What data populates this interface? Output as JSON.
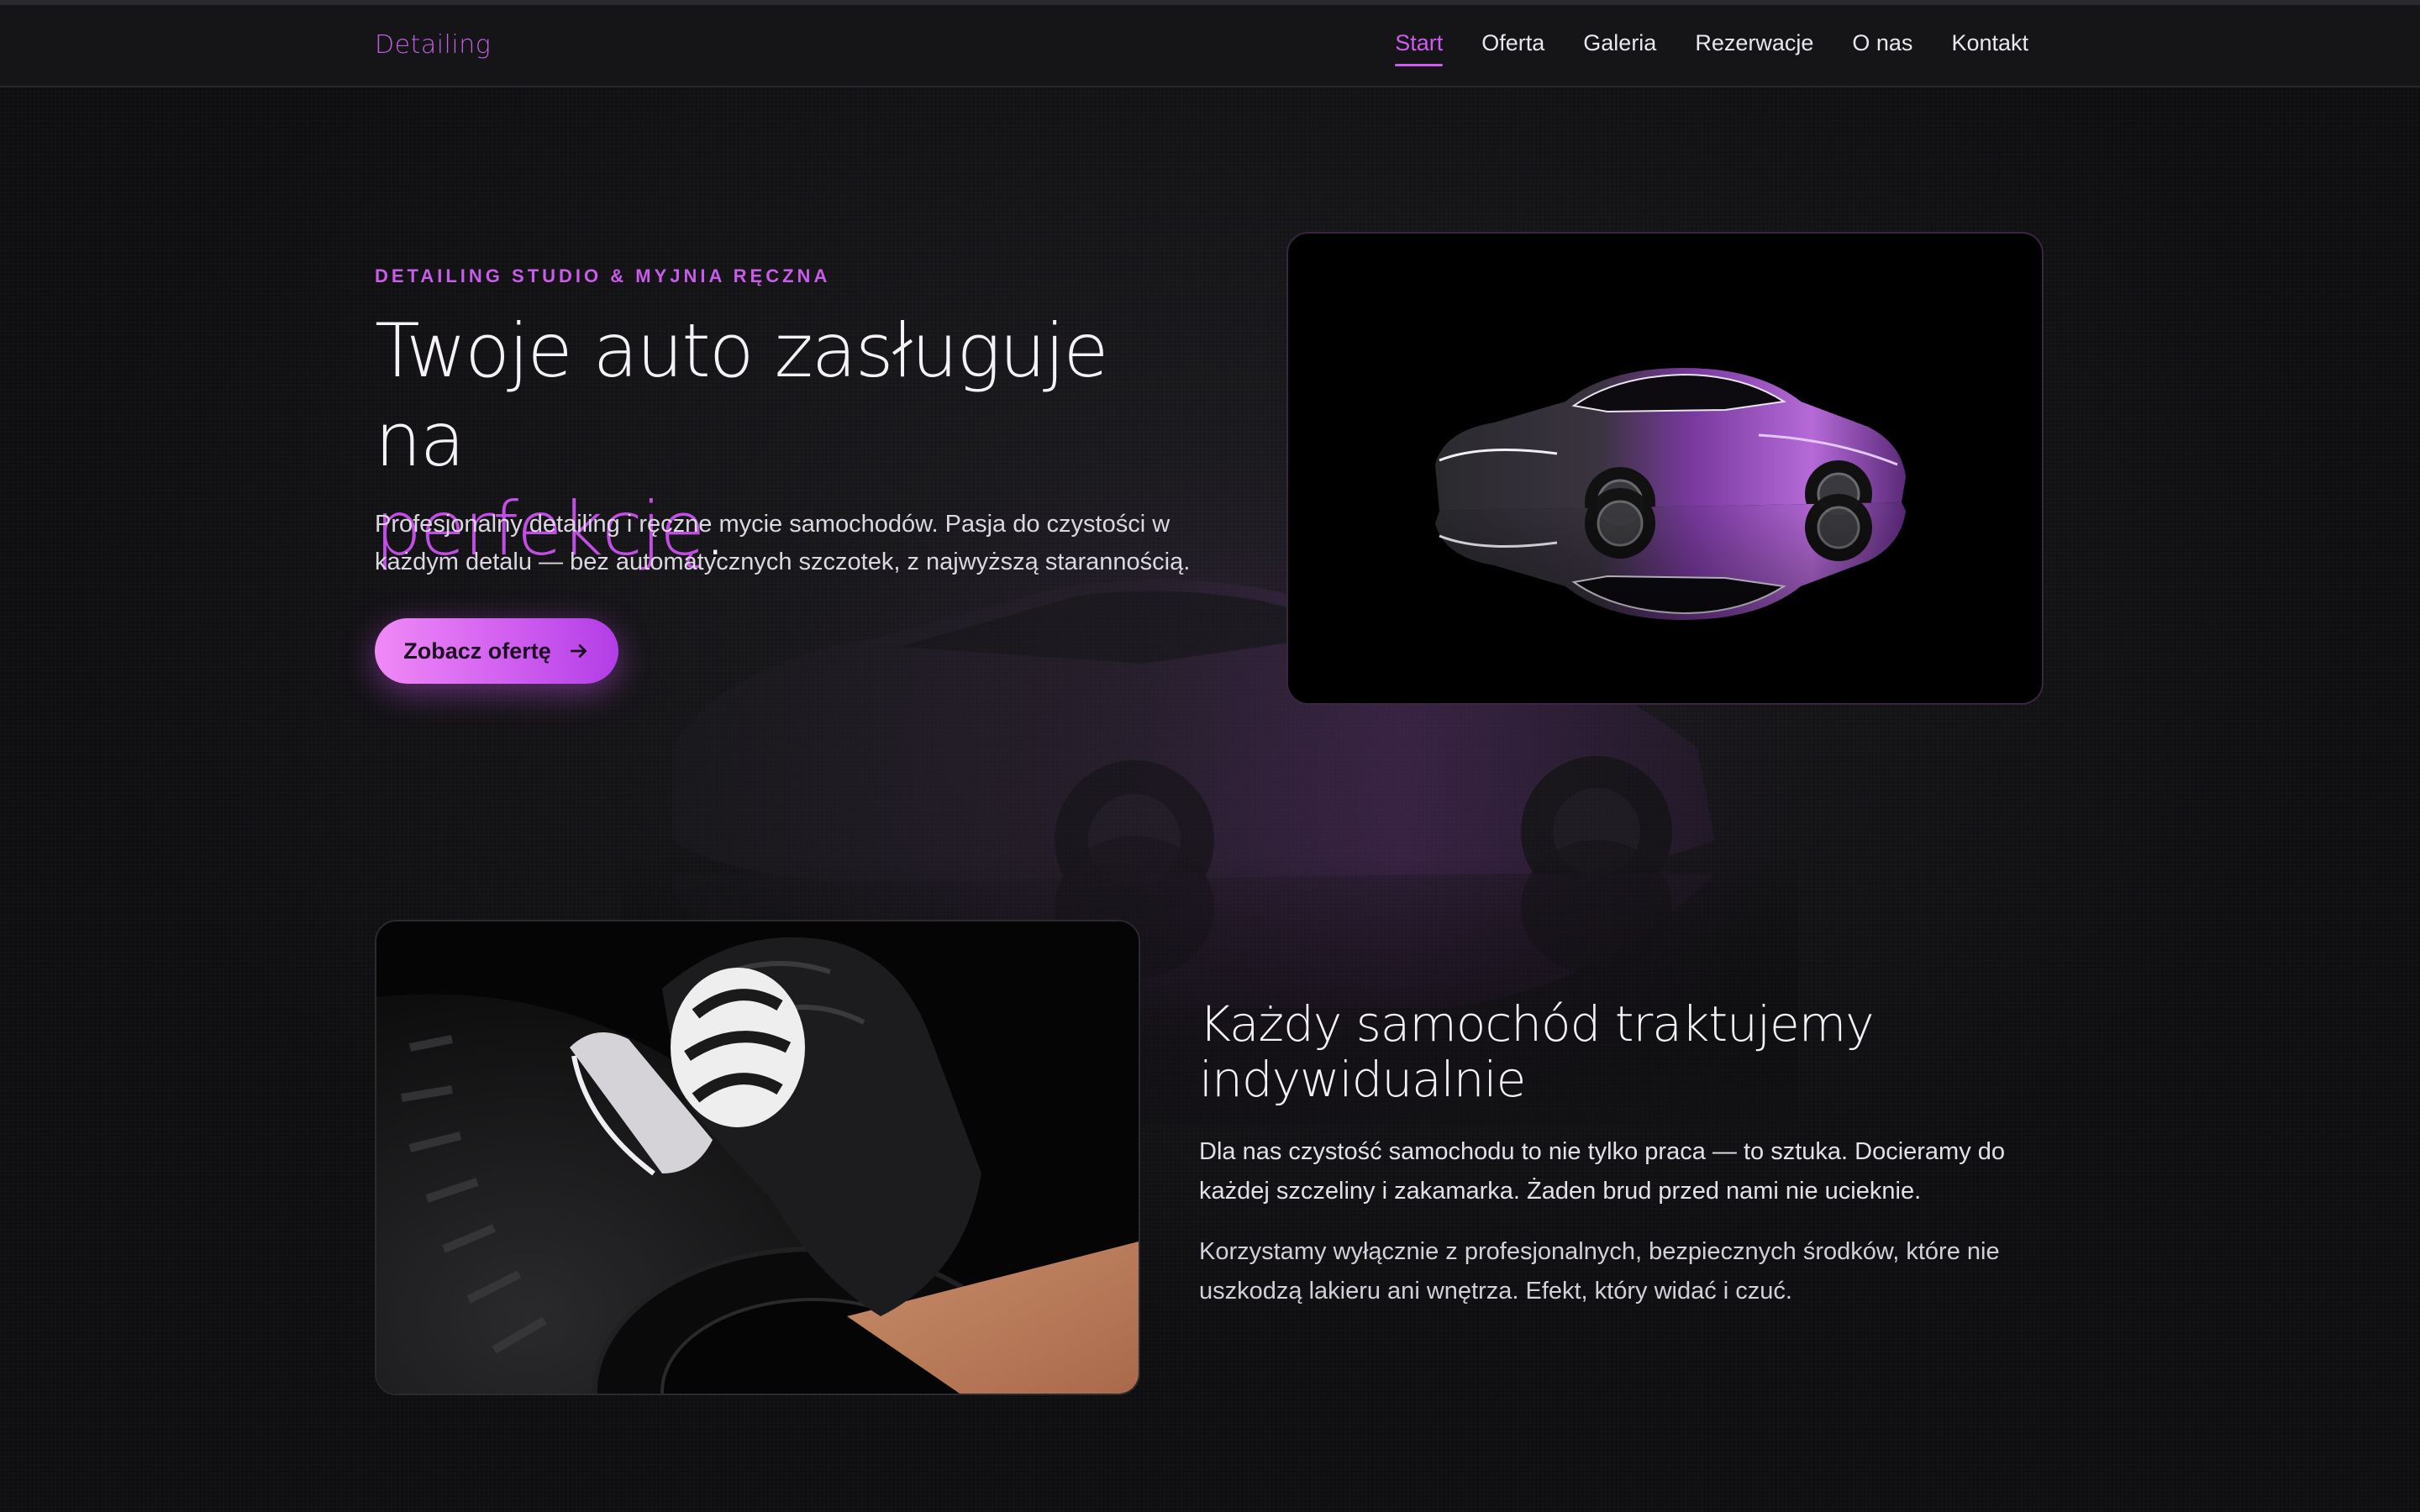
{
  "nav": {
    "logo": "Detailing",
    "links": [
      {
        "label": "Start",
        "active": true
      },
      {
        "label": "Oferta",
        "active": false
      },
      {
        "label": "Galeria",
        "active": false
      },
      {
        "label": "Rezerwacje",
        "active": false
      },
      {
        "label": "O nas",
        "active": false
      },
      {
        "label": "Kontakt",
        "active": false
      }
    ]
  },
  "hero": {
    "eyebrow": "DETAILING STUDIO & MYJNIA RĘCZNA",
    "title_line1": "Twoje auto zasługuje na",
    "title_accent": "perfekcję",
    "title_end": ".",
    "description": "Profesjonalny detailing i ręczne mycie samochodów. Pasja do czystości w każdym detalu — bez automatycznych szczotek, z najwyższą starannością.",
    "cta_label": "Zobacz ofertę"
  },
  "about": {
    "title": "Każdy samochód traktujemy indywidualnie",
    "paragraph1": "Dla nas czystość samochodu to nie tylko praca — to sztuka. Docieramy do każdej szczeliny i zakamarka. Żaden brud przed nami nie ucieknie.",
    "paragraph2": "Korzystamy wyłącznie z profesjonalnych, bezpiecznych środków, które nie uszkodzą lakieru ani wnętrza. Efekt, który widać i czuć."
  },
  "colors": {
    "accent": "#c24ee6",
    "background": "#131215",
    "button_gradient_start": "#f08af6",
    "button_gradient_end": "#b23de6"
  },
  "icons": {
    "cta_icon": "arrow-right-icon"
  }
}
